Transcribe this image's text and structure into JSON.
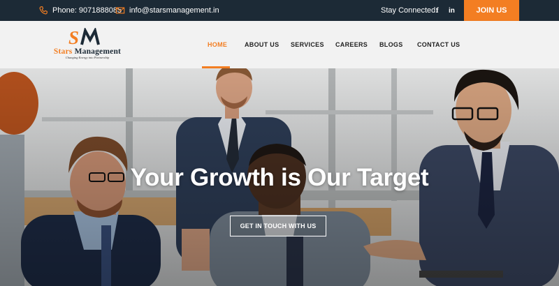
{
  "topbar": {
    "phone": "Phone: 9071888085",
    "email": "info@starsmanagement.in",
    "stay_connected": "Stay Connected:",
    "facebook": "f",
    "linkedin": "in",
    "join_label": "JOIN US"
  },
  "logo": {
    "mark": "SM",
    "name_part1": "Stars",
    "name_part2": "Management",
    "tagline": "Changing Energy into Partnership"
  },
  "nav": {
    "items": [
      "HOME",
      "ABOUT US",
      "SERVICES",
      "CAREERS",
      "BLOGS",
      "CONTACT US"
    ],
    "active": "HOME"
  },
  "hero": {
    "title": "Your Growth is Our Target",
    "cta_label": "GET IN TOUCH WITH US"
  },
  "colors": {
    "accent": "#f37e22",
    "topbar_bg": "#1c2a36",
    "nav_bg": "#f2f2f2",
    "text_dark": "#222222"
  },
  "icons": [
    "phone-icon",
    "mail-icon",
    "facebook-icon",
    "linkedin-icon"
  ]
}
